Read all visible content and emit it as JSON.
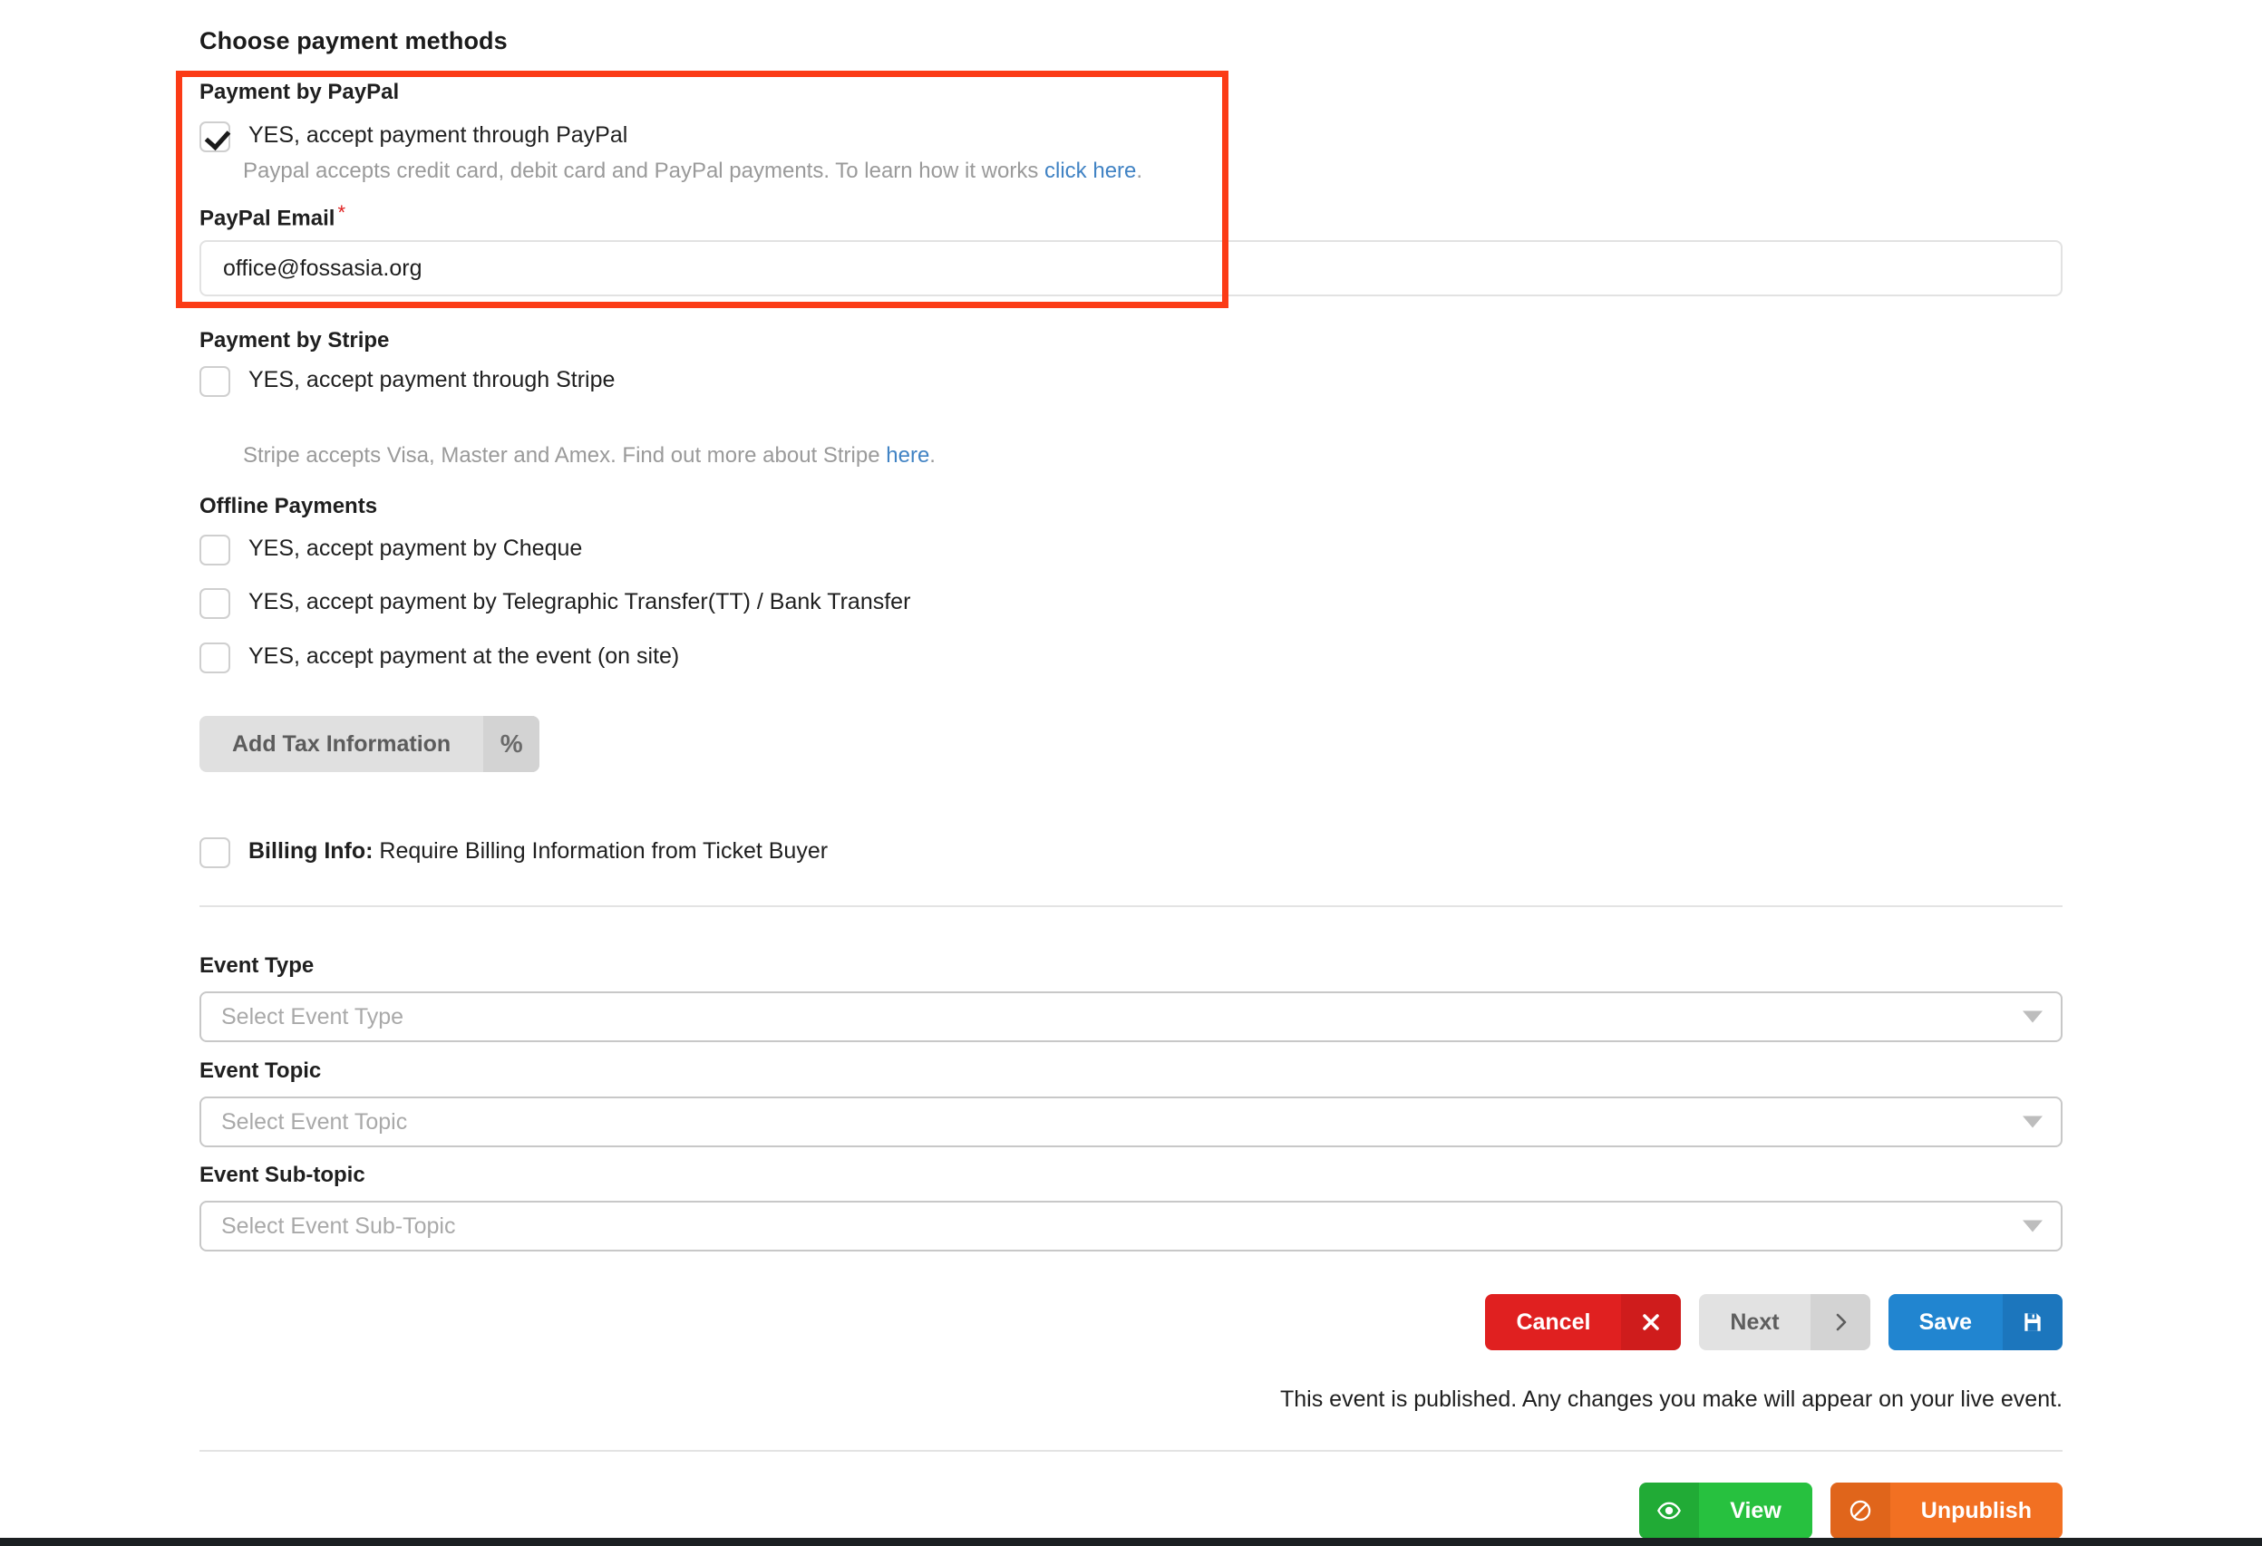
{
  "section": {
    "title": "Choose payment methods"
  },
  "paypal": {
    "group_label": "Payment by PayPal",
    "checkbox_label": "YES, accept payment through PayPal",
    "checked": true,
    "helper_prefix": "Paypal accepts credit card, debit card and PayPal payments. To learn how it works ",
    "helper_link": "click here",
    "helper_suffix": ".",
    "email_label": "PayPal Email",
    "required_marker": "*",
    "email_value": "office@fossasia.org",
    "email_placeholder": "PayPal Email"
  },
  "stripe": {
    "group_label": "Payment by Stripe",
    "checkbox_label": "YES, accept payment through Stripe",
    "checked": false,
    "helper_prefix": "Stripe accepts Visa, Master and Amex. Find out more about Stripe ",
    "helper_link": "here",
    "helper_suffix": "."
  },
  "offline": {
    "group_label": "Offline Payments",
    "items": [
      {
        "label": "YES, accept payment by Cheque",
        "checked": false
      },
      {
        "label": "YES, accept payment by Telegraphic Transfer(TT) / Bank Transfer",
        "checked": false
      },
      {
        "label": "YES, accept payment at the event (on site)",
        "checked": false
      }
    ]
  },
  "tax": {
    "button_label": "Add Tax Information",
    "icon": "percent-icon",
    "icon_glyph": "%"
  },
  "billing": {
    "label_bold": "Billing Info:",
    "label_rest": " Require Billing Information from Ticket Buyer",
    "checked": false
  },
  "event_fields": [
    {
      "label": "Event Type",
      "placeholder": "Select Event Type",
      "value": ""
    },
    {
      "label": "Event Topic",
      "placeholder": "Select Event Topic",
      "value": ""
    },
    {
      "label": "Event Sub-topic",
      "placeholder": "Select Event Sub-Topic",
      "value": ""
    }
  ],
  "actions": {
    "cancel": {
      "label": "Cancel",
      "icon": "close-icon",
      "glyph": "✖"
    },
    "next": {
      "label": "Next",
      "icon": "chevron-right-icon",
      "glyph": "›"
    },
    "save": {
      "label": "Save",
      "icon": "floppy-disk-icon",
      "glyph": "Ὃe"
    }
  },
  "publish": {
    "status_text": "This event is published. Any changes you make will appear on your live event.",
    "view": {
      "label": "View",
      "icon": "eye-icon"
    },
    "unpublish": {
      "label": "Unpublish",
      "icon": "no-entry-icon"
    }
  },
  "colors": {
    "highlight_border": "#fb3b16",
    "link": "#4183c4",
    "cancel": "#e02020",
    "save": "#2185d0",
    "view": "#27c13f",
    "unpublish": "#f27022",
    "required": "#e02020"
  }
}
